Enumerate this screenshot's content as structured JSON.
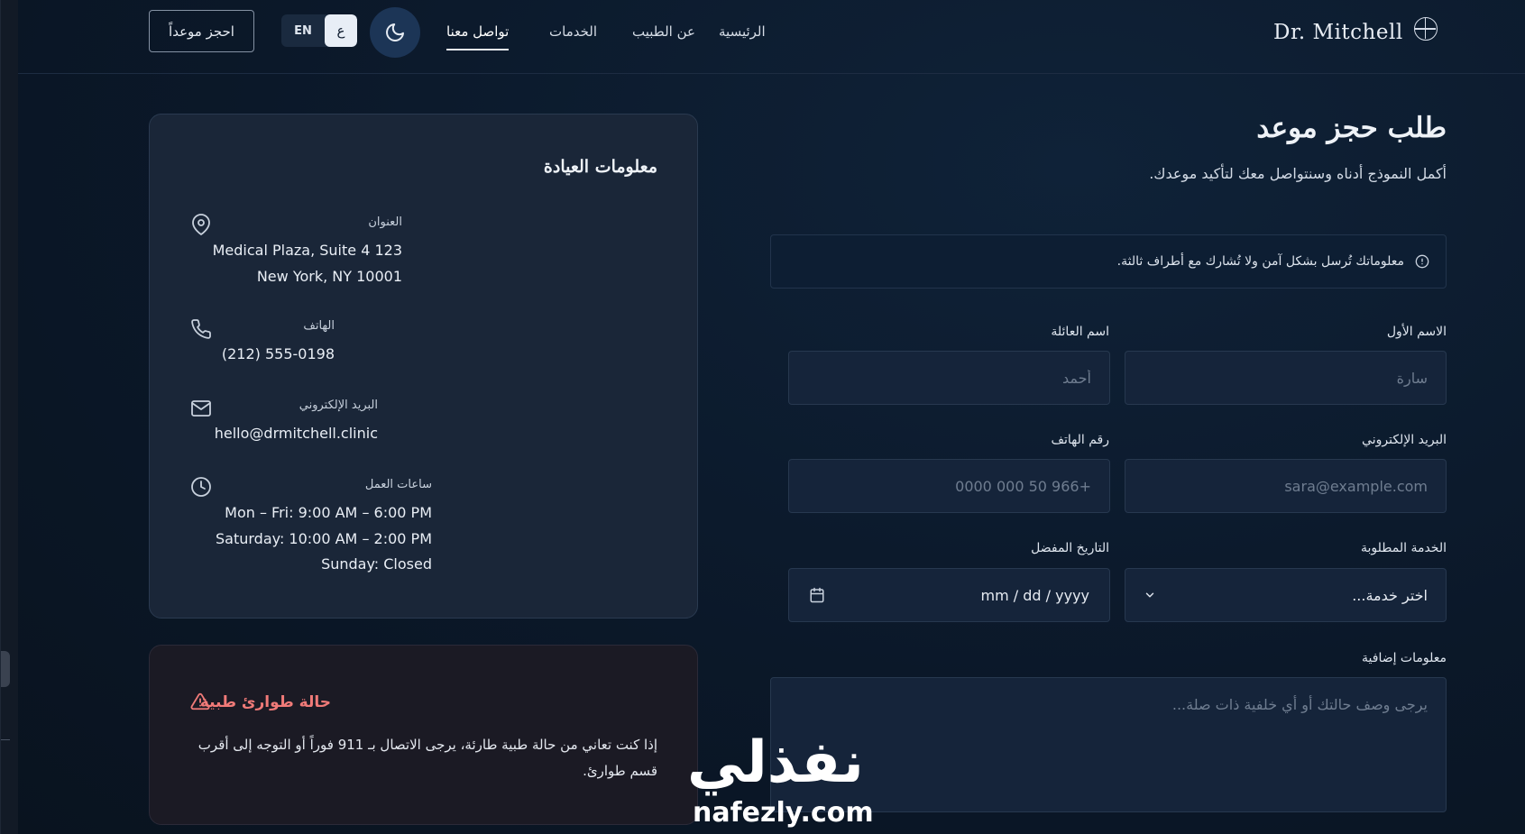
{
  "brand": {
    "name": "Dr. Mitchell",
    "icon": "medical-cross-icon"
  },
  "nav": {
    "home": "الرئيسية",
    "about": "عن الطبيب",
    "services": "الخدمات",
    "contact": "تواصل معنا"
  },
  "header": {
    "theme_icon": "moon-icon",
    "lang_en": "EN",
    "lang_ar": "ع",
    "book_label": "احجز موعداً"
  },
  "form": {
    "title": "طلب حجز موعد",
    "subtitle": "أكمل النموذج أدناه وسنتواصل معك لتأكيد موعدك.",
    "notice": "معلوماتك تُرسل بشكل آمن ولا تُشارك مع أطراف ثالثة.",
    "first_name": {
      "label": "الاسم الأول",
      "placeholder": "سارة"
    },
    "last_name": {
      "label": "اسم العائلة",
      "placeholder": "أحمد"
    },
    "email": {
      "label": "البريد الإلكتروني",
      "placeholder": "sara@example.com"
    },
    "phone": {
      "label": "رقم الهاتف",
      "placeholder": "+966 50 000 0000"
    },
    "service": {
      "label": "الخدمة المطلوبة",
      "value": "اختر خدمة..."
    },
    "date": {
      "label": "التاريخ المفضل",
      "value": "mm / dd / yyyy"
    },
    "notes": {
      "label": "معلومات إضافية",
      "placeholder": "يرجى وصف حالتك أو أي خلفية ذات صلة..."
    }
  },
  "clinic": {
    "title": "معلومات العيادة",
    "address": {
      "label": "العنوان",
      "line1": "Medical Plaza, Suite 4 123",
      "line2": "New York, NY 10001"
    },
    "phone": {
      "label": "الهاتف",
      "value": "(212) 555-0198"
    },
    "email": {
      "label": "البريد الإلكتروني",
      "value": "hello@drmitchell.clinic"
    },
    "hours": {
      "label": "ساعات العمل",
      "weekdays": "Mon – Fri: 9:00 AM – 6:00 PM",
      "saturday": "Saturday: 10:00 AM – 2:00 PM",
      "sunday": "Sunday: Closed"
    }
  },
  "emergency": {
    "title": "حالة طوارئ طبية",
    "text": "إذا كنت تعاني من حالة طبية طارئة، يرجى الاتصال بـ 911 فوراً أو التوجه إلى أقرب قسم طوارئ."
  },
  "watermark": {
    "arabic": "نفذلي",
    "latin": "nafezly.com"
  },
  "colors": {
    "background": "#0b1829",
    "card": "#1a2638",
    "accent_emergency": "#f07a78",
    "theme_button": "#1c3556"
  }
}
